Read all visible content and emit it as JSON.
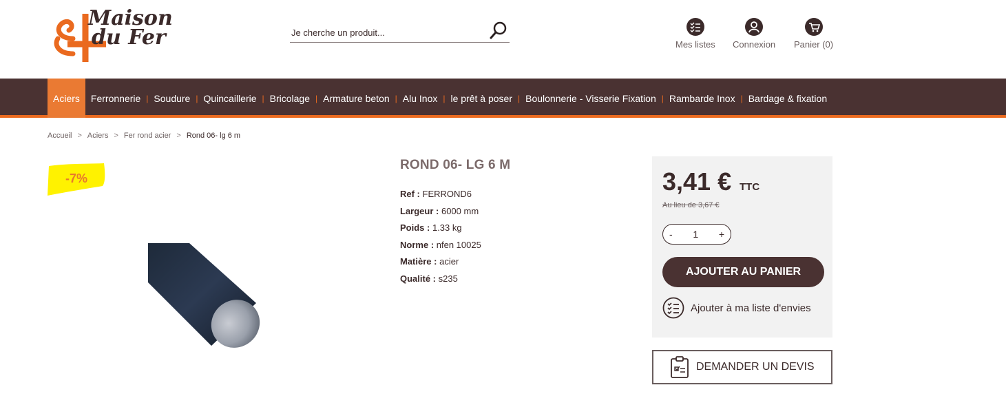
{
  "brand": {
    "line1": "Maison",
    "line2": "du Fer"
  },
  "search": {
    "placeholder": "Je cherche un produit..."
  },
  "header_links": {
    "lists": "Mes listes",
    "login": "Connexion",
    "cart": "Panier (0)"
  },
  "nav": {
    "items": [
      "Aciers",
      "Ferronnerie",
      "Soudure",
      "Quincaillerie",
      "Bricolage",
      "Armature beton",
      "Alu Inox",
      "le prêt à poser",
      "Boulonnerie - Visserie Fixation",
      "Rambarde Inox",
      "Bardage & fixation"
    ],
    "active": "Aciers"
  },
  "breadcrumb": {
    "items": [
      "Accueil",
      "Aciers",
      "Fer rond acier"
    ],
    "current": "Rond 06- lg 6 m",
    "separator": ">"
  },
  "badge": {
    "text": "-7%"
  },
  "product": {
    "title": "ROND 06- LG 6 M",
    "specs": [
      {
        "label": "Ref :",
        "value": "FERROND6"
      },
      {
        "label": "Largeur :",
        "value": "6000 mm"
      },
      {
        "label": "Poids :",
        "value": "1.33 kg"
      },
      {
        "label": "Norme :",
        "value": "nfen 10025"
      },
      {
        "label": "Matière :",
        "value": "acier"
      },
      {
        "label": "Qualité :",
        "value": "s235"
      }
    ]
  },
  "pricing": {
    "price": "3,41 €",
    "tax_label": "TTC",
    "old_price": "Au lieu de 3,67 €",
    "qty_minus": "-",
    "qty_value": "1",
    "qty_plus": "+",
    "add_to_cart": "AJOUTER AU PANIER",
    "wishlist": "Ajouter à ma liste d'envies"
  },
  "quote": {
    "label": "DEMANDER UN DEVIS"
  },
  "colors": {
    "brown": "#4a3232",
    "orange": "#ea6a1f",
    "badge_yellow": "#fff200",
    "panel_gray": "#f2f2f2"
  }
}
